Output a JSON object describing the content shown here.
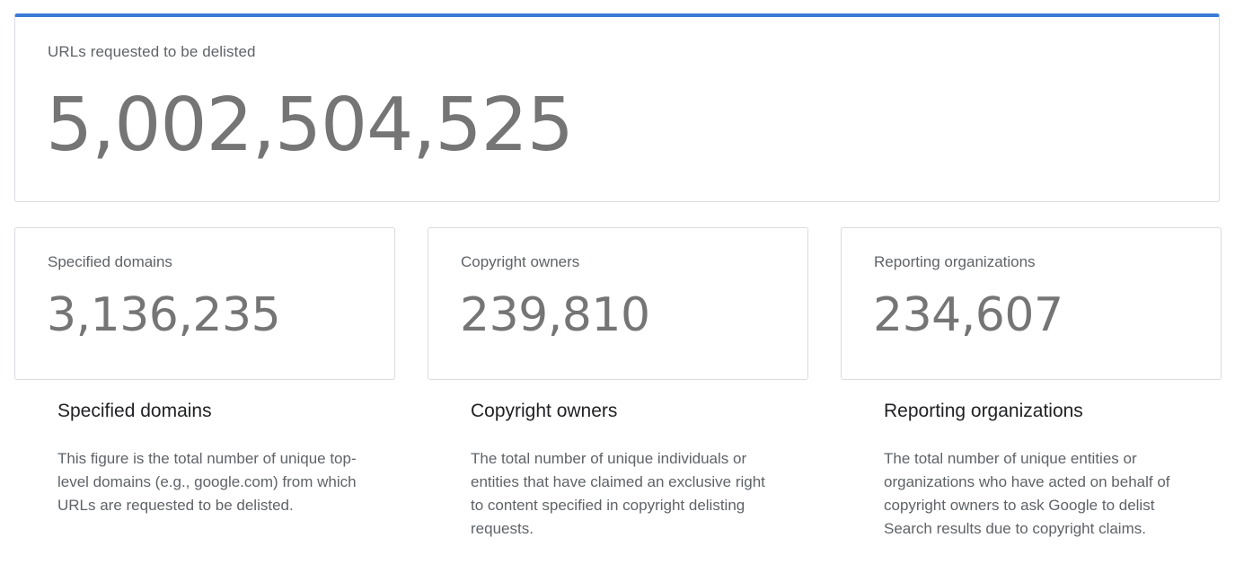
{
  "hero": {
    "label": "URLs requested to be delisted",
    "value": "5,002,504,525"
  },
  "accent_color": "#3a7bd5",
  "stats": [
    {
      "label": "Specified domains",
      "value": "3,136,235"
    },
    {
      "label": "Copyright owners",
      "value": "239,810"
    },
    {
      "label": "Reporting organizations",
      "value": "234,607"
    }
  ],
  "descriptions": [
    {
      "title": "Specified domains",
      "text": "This figure is the total number of unique top-level domains (e.g., google.com) from which URLs are requested to be delisted."
    },
    {
      "title": "Copyright owners",
      "text": "The total number of unique individuals or entities that have claimed an exclusive right to content specified in copyright delisting requests."
    },
    {
      "title": "Reporting organizations",
      "text": "The total number of unique entities or organizations who have acted on behalf of copyright owners to ask Google to delist Search results due to copyright claims."
    }
  ]
}
